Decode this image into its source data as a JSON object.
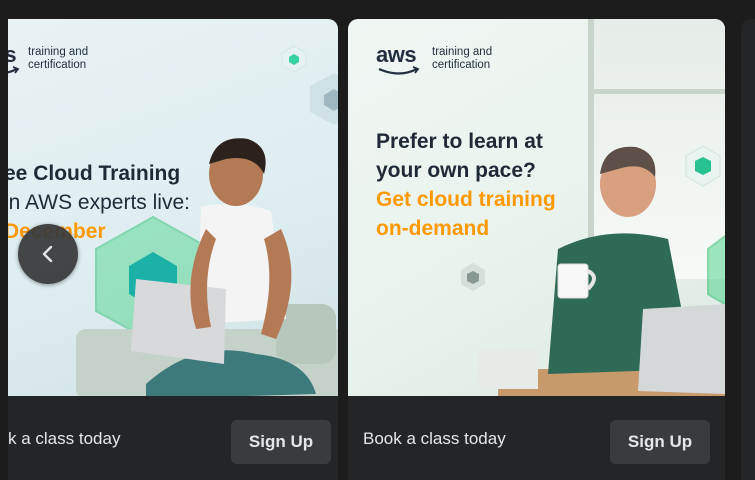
{
  "carousel": {
    "cards": [
      {
        "logo_word": "aws",
        "logo_tagline_1": "training and",
        "logo_tagline_2": "certification",
        "headline_1": "ee Cloud Training",
        "headline_2": "in AWS experts live:",
        "headline_3": "December",
        "footer_title": "k a class today",
        "cta_label": "Sign Up"
      },
      {
        "logo_word": "aws",
        "logo_tagline_1": "training and",
        "logo_tagline_2": "certification",
        "headline_1": "Prefer to learn at",
        "headline_2": "your own pace?",
        "headline_3": "Get cloud training",
        "headline_4": "on-demand",
        "footer_title": "Book a class today",
        "cta_label": "Sign Up"
      }
    ],
    "prev_icon": "chevron-left-icon"
  },
  "colors": {
    "accent_orange": "#ff9900",
    "card_bg": "#242526",
    "button_bg": "#3a3b3c",
    "page_bg": "#1c1c1d"
  }
}
